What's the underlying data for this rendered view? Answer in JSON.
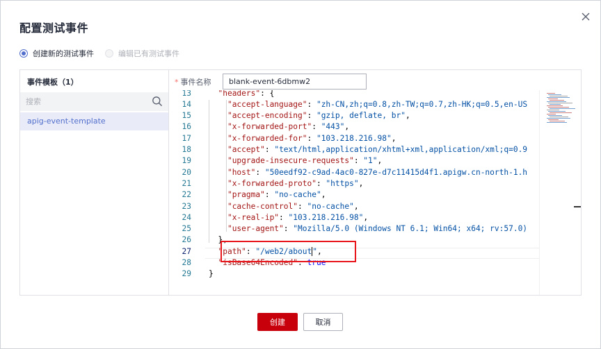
{
  "dialog": {
    "title": "配置测试事件",
    "close_icon": "close-icon"
  },
  "mode": {
    "options": [
      {
        "label": "创建新的测试事件",
        "selected": true,
        "enabled": true
      },
      {
        "label": "编辑已有测试事件",
        "selected": false,
        "enabled": false
      }
    ]
  },
  "templates": {
    "title": "事件模板（1）",
    "search_placeholder": "搜索",
    "search_icon": "search-icon",
    "items": [
      "apig-event-template"
    ]
  },
  "event_name": {
    "label": "事件名称",
    "required_mark": "*",
    "value": "blank-event-6dbmw2"
  },
  "editor": {
    "lines": [
      {
        "n": "13",
        "segments": [
          {
            "t": "  ",
            "c": ""
          },
          {
            "t": "\"headers\"",
            "c": "key"
          },
          {
            "t": ": {",
            "c": ""
          }
        ]
      },
      {
        "n": "14",
        "segments": [
          {
            "t": "    ",
            "c": ""
          },
          {
            "t": "\"accept-language\"",
            "c": "key"
          },
          {
            "t": ": ",
            "c": ""
          },
          {
            "t": "\"zh-CN,zh;q=0.8,zh-TW;q=0.7,zh-HK;q=0.5,en-US",
            "c": "str"
          }
        ]
      },
      {
        "n": "15",
        "segments": [
          {
            "t": "    ",
            "c": ""
          },
          {
            "t": "\"accept-encoding\"",
            "c": "key"
          },
          {
            "t": ": ",
            "c": ""
          },
          {
            "t": "\"gzip, deflate, br\"",
            "c": "str"
          },
          {
            "t": ",",
            "c": ""
          }
        ]
      },
      {
        "n": "16",
        "segments": [
          {
            "t": "    ",
            "c": ""
          },
          {
            "t": "\"x-forwarded-port\"",
            "c": "key"
          },
          {
            "t": ": ",
            "c": ""
          },
          {
            "t": "\"443\"",
            "c": "str"
          },
          {
            "t": ",",
            "c": ""
          }
        ]
      },
      {
        "n": "17",
        "segments": [
          {
            "t": "    ",
            "c": ""
          },
          {
            "t": "\"x-forwarded-for\"",
            "c": "key"
          },
          {
            "t": ": ",
            "c": ""
          },
          {
            "t": "\"103.218.216.98\"",
            "c": "str"
          },
          {
            "t": ",",
            "c": ""
          }
        ]
      },
      {
        "n": "18",
        "segments": [
          {
            "t": "    ",
            "c": ""
          },
          {
            "t": "\"accept\"",
            "c": "key"
          },
          {
            "t": ": ",
            "c": ""
          },
          {
            "t": "\"text/html,application/xhtml+xml,application/xml;q=0.9",
            "c": "str"
          }
        ]
      },
      {
        "n": "19",
        "segments": [
          {
            "t": "    ",
            "c": ""
          },
          {
            "t": "\"upgrade-insecure-requests\"",
            "c": "key"
          },
          {
            "t": ": ",
            "c": ""
          },
          {
            "t": "\"1\"",
            "c": "str"
          },
          {
            "t": ",",
            "c": ""
          }
        ]
      },
      {
        "n": "20",
        "segments": [
          {
            "t": "    ",
            "c": ""
          },
          {
            "t": "\"host\"",
            "c": "key"
          },
          {
            "t": ": ",
            "c": ""
          },
          {
            "t": "\"50eedf92-c9ad-4ac0-827e-d7c11415d4f1.apigw.cn-north-1.h",
            "c": "str"
          }
        ]
      },
      {
        "n": "21",
        "segments": [
          {
            "t": "    ",
            "c": ""
          },
          {
            "t": "\"x-forwarded-proto\"",
            "c": "key"
          },
          {
            "t": ": ",
            "c": ""
          },
          {
            "t": "\"https\"",
            "c": "str"
          },
          {
            "t": ",",
            "c": ""
          }
        ]
      },
      {
        "n": "22",
        "segments": [
          {
            "t": "    ",
            "c": ""
          },
          {
            "t": "\"pragma\"",
            "c": "key"
          },
          {
            "t": ": ",
            "c": ""
          },
          {
            "t": "\"no-cache\"",
            "c": "str"
          },
          {
            "t": ",",
            "c": ""
          }
        ]
      },
      {
        "n": "23",
        "segments": [
          {
            "t": "    ",
            "c": ""
          },
          {
            "t": "\"cache-control\"",
            "c": "key"
          },
          {
            "t": ": ",
            "c": ""
          },
          {
            "t": "\"no-cache\"",
            "c": "str"
          },
          {
            "t": ",",
            "c": ""
          }
        ]
      },
      {
        "n": "24",
        "segments": [
          {
            "t": "    ",
            "c": ""
          },
          {
            "t": "\"x-real-ip\"",
            "c": "key"
          },
          {
            "t": ": ",
            "c": ""
          },
          {
            "t": "\"103.218.216.98\"",
            "c": "str"
          },
          {
            "t": ",",
            "c": ""
          }
        ]
      },
      {
        "n": "25",
        "segments": [
          {
            "t": "    ",
            "c": ""
          },
          {
            "t": "\"user-agent\"",
            "c": "key"
          },
          {
            "t": ": ",
            "c": ""
          },
          {
            "t": "\"Mozilla/5.0 (Windows NT 6.1; Win64; x64; rv:57.0)",
            "c": "str"
          }
        ]
      },
      {
        "n": "26",
        "segments": [
          {
            "t": "  },",
            "c": ""
          }
        ]
      },
      {
        "n": "27",
        "segments": [
          {
            "t": "  ",
            "c": ""
          },
          {
            "t": "\"path\"",
            "c": "key"
          },
          {
            "t": ": ",
            "c": ""
          },
          {
            "t": "\"/web2/about",
            "c": "str"
          },
          {
            "t": "|caret|",
            "c": "caret"
          },
          {
            "t": "\"",
            "c": "str"
          },
          {
            "t": ",",
            "c": ""
          }
        ],
        "current": true
      },
      {
        "n": "28",
        "segments": [
          {
            "t": "  ",
            "c": ""
          },
          {
            "t": "\"isBase64Encoded\"",
            "c": "key"
          },
          {
            "t": ": ",
            "c": ""
          },
          {
            "t": "true",
            "c": "kw"
          }
        ]
      },
      {
        "n": "29",
        "segments": [
          {
            "t": "}",
            "c": ""
          }
        ]
      }
    ]
  },
  "buttons": {
    "create": "创建",
    "cancel": "取消"
  },
  "colors": {
    "accent": "#526ecc",
    "primary_button": "#c7000b",
    "highlight_box": "#e8151b",
    "json_key": "#a31515",
    "json_string": "#0451a5",
    "json_keyword": "#0000ff",
    "line_number": "#237893"
  }
}
